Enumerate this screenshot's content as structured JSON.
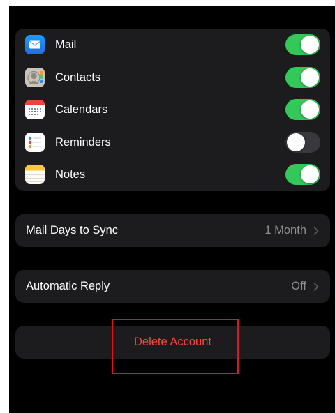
{
  "services": {
    "items": [
      {
        "label": "Mail",
        "icon": "mail-icon",
        "enabled": true
      },
      {
        "label": "Contacts",
        "icon": "contacts-icon",
        "enabled": true
      },
      {
        "label": "Calendars",
        "icon": "calendar-icon",
        "enabled": true
      },
      {
        "label": "Reminders",
        "icon": "reminders-icon",
        "enabled": false
      },
      {
        "label": "Notes",
        "icon": "notes-icon",
        "enabled": true
      }
    ]
  },
  "sync": {
    "label": "Mail Days to Sync",
    "value": "1 Month"
  },
  "reply": {
    "label": "Automatic Reply",
    "value": "Off"
  },
  "delete": {
    "label": "Delete Account"
  },
  "colors": {
    "toggle_on": "#34c759",
    "toggle_off": "#39393d",
    "destructive": "#ff453a",
    "secondary_text": "#8e8e93",
    "cell_background": "#1c1c1e",
    "highlight": "#e0161c"
  }
}
